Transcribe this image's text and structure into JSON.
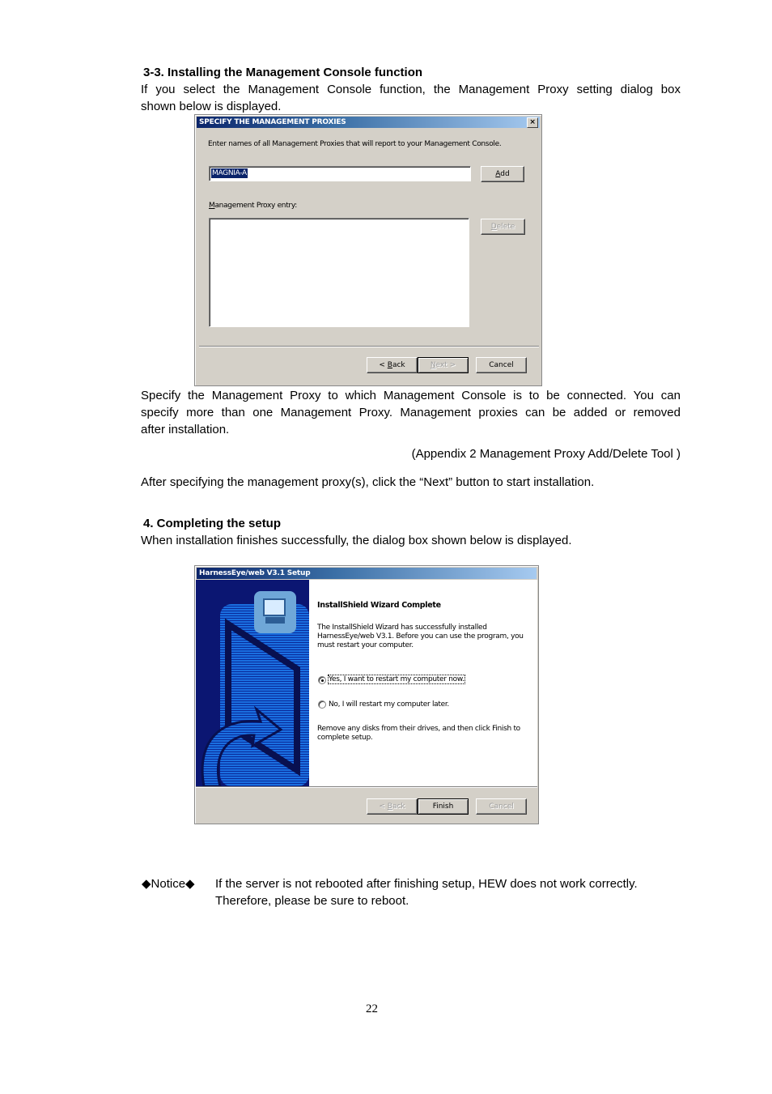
{
  "section_3_3": {
    "heading": "3-3. Installing the Management Console function",
    "intro_line1": "If you select the Management Console function, the Management Proxy setting dialog box",
    "intro_line2": "shown below is displayed."
  },
  "proxy_dialog": {
    "title": "SPECIFY THE MANAGEMENT PROXIES",
    "close_label": "×",
    "instruction": "Enter names of all Management Proxies that will report to your Management Console.",
    "proxy_input_value": "MAGNIA-A",
    "add_button": {
      "accel": "A",
      "rest": "dd"
    },
    "list_label": {
      "accel": "M",
      "rest": "anagement Proxy entry:"
    },
    "list_items": [],
    "delete_button": {
      "accel": "D",
      "rest": "elete"
    },
    "back_button": {
      "prefix": "< ",
      "accel": "B",
      "rest": "ack"
    },
    "next_button": {
      "accel": "N",
      "rest": "ext >"
    },
    "cancel_button": "Cancel"
  },
  "after_dialog1": {
    "line1": "Specify the Management Proxy to which Management Console is to be connected. You can",
    "line2": "specify more than one Management Proxy. Management proxies can be added or removed",
    "line3": "after installation.",
    "appendix_ref": "(Appendix 2 Management Proxy Add/Delete Tool )",
    "next_hint": "After specifying the management proxy(s), click the “Next” button to start installation."
  },
  "section_4": {
    "heading": "4. Completing the setup",
    "intro": "When installation finishes successfully, the dialog box shown below is displayed."
  },
  "setup_dialog": {
    "title": "HarnessEye/web V3.1 Setup",
    "heading": "InstallShield Wizard Complete",
    "body_line1": "The InstallShield Wizard has successfully installed",
    "body_line2": "HarnessEye/web V3.1.  Before you can use the program, you",
    "body_line3": "must restart your computer.",
    "radio_options": [
      {
        "label": "Yes, I want to restart my computer now.",
        "checked": true
      },
      {
        "label": "No, I will restart my computer later.",
        "checked": false
      }
    ],
    "remove_line1": "Remove any disks from their drives, and then click Finish to",
    "remove_line2": "complete setup.",
    "back_button": {
      "prefix": "< ",
      "accel": "B",
      "rest": "ack"
    },
    "finish_button": "Finish",
    "cancel_button": "Cancel"
  },
  "notice": {
    "label": "◆Notice◆",
    "line1": "If the server is not rebooted after finishing setup, HEW does not work correctly.",
    "line2": "Therefore, please be sure to reboot."
  },
  "page_number": "22"
}
